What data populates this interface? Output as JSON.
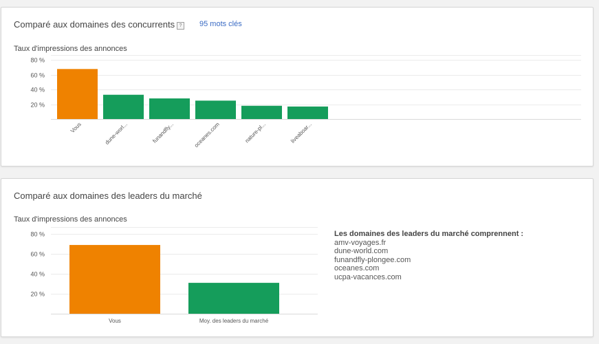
{
  "competitors": {
    "title": "Comparé aux domaines des concurrents",
    "help_glyph": "?",
    "keywords_link": "95 mots clés",
    "metric_label": "Taux d'impressions des annonces"
  },
  "leaders": {
    "title": "Comparé aux domaines des leaders du marché",
    "metric_label": "Taux d'impressions des annonces",
    "list_title": "Les domaines des leaders du marché comprennent :",
    "domains": [
      "amv-voyages.fr",
      "dune-world.com",
      "funandfly-plongee.com",
      "oceanes.com",
      "ucpa-vacances.com"
    ]
  },
  "colors": {
    "you": "#ef8200",
    "others": "#159d5b"
  },
  "chart_data": [
    {
      "type": "bar",
      "title": "",
      "ylabel": "Taux d'impressions des annonces",
      "ylim": [
        0,
        87
      ],
      "yticks": [
        "20 %",
        "40 %",
        "60 %",
        "80 %"
      ],
      "ytick_values": [
        20,
        40,
        60,
        80
      ],
      "grid": true,
      "categories": [
        "Vous",
        "dune-worl...",
        "funandfly...",
        "oceanes.com",
        "nature-pl...",
        "liveaboar..."
      ],
      "values": [
        68,
        33,
        28,
        25,
        18,
        17
      ]
    },
    {
      "type": "bar",
      "title": "",
      "ylabel": "Taux d'impressions des annonces",
      "ylim": [
        0,
        87
      ],
      "yticks": [
        "20 %",
        "40 %",
        "60 %",
        "80 %"
      ],
      "ytick_values": [
        20,
        40,
        60,
        80
      ],
      "grid": true,
      "categories": [
        "Vous",
        "Moy. des leaders du marché"
      ],
      "values": [
        69,
        31
      ]
    }
  ]
}
